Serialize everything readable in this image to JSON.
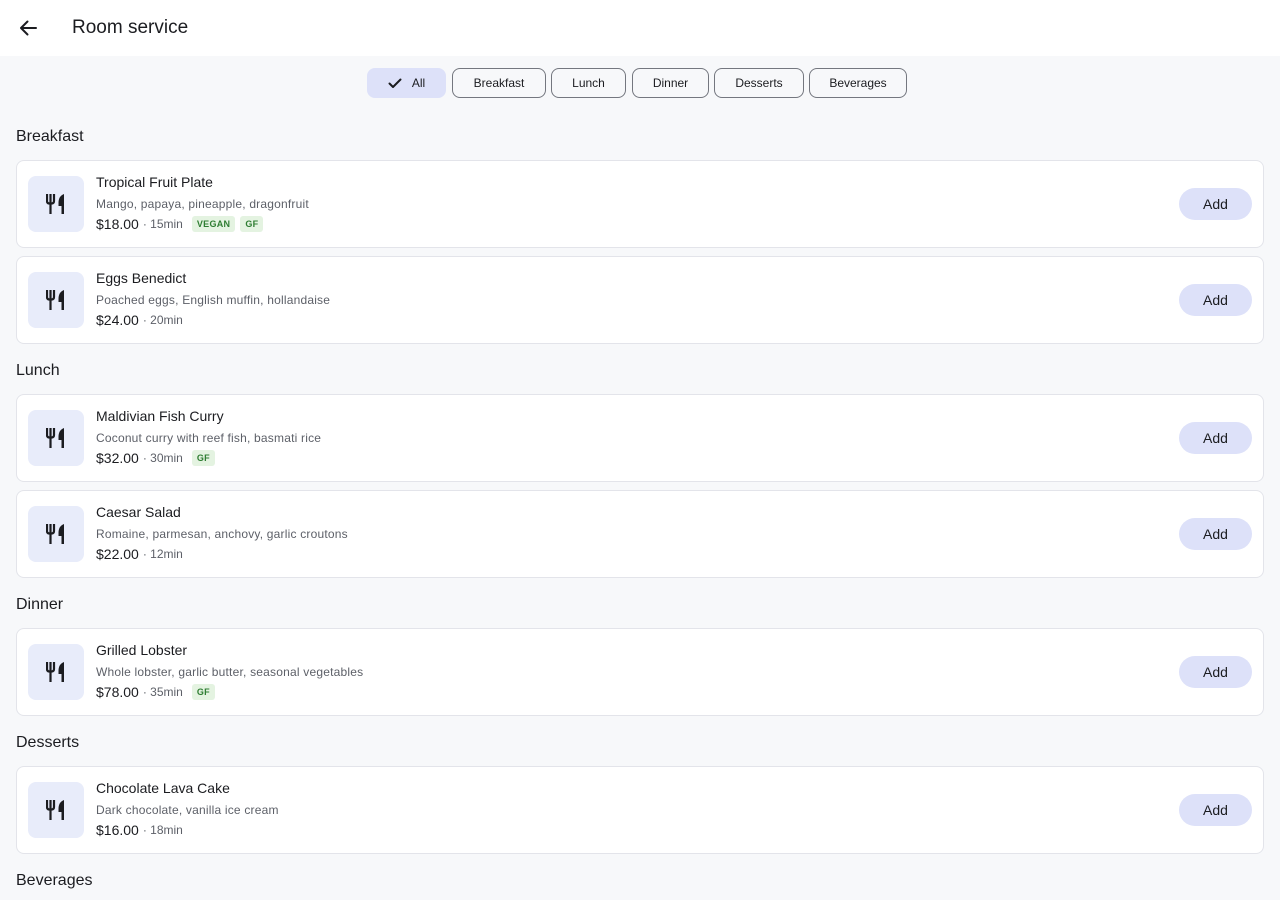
{
  "app_bar": {
    "title": "Room service",
    "back_icon": "arrow-back-icon"
  },
  "filters": [
    {
      "label": "All",
      "selected": true
    },
    {
      "label": "Breakfast",
      "selected": false
    },
    {
      "label": "Lunch",
      "selected": false
    },
    {
      "label": "Dinner",
      "selected": false
    },
    {
      "label": "Desserts",
      "selected": false
    },
    {
      "label": "Beverages",
      "selected": false
    }
  ],
  "sections": [
    {
      "title": "Breakfast",
      "items": [
        {
          "name": "Tropical Fruit Plate",
          "description": "Mango, papaya, pineapple, dragonfruit",
          "price": "$18.00",
          "time": "· 15min",
          "tags": [
            "VEGAN",
            "GF"
          ],
          "add_label": "Add"
        },
        {
          "name": "Eggs Benedict",
          "description": "Poached eggs, English muffin, hollandaise",
          "price": "$24.00",
          "time": "· 20min",
          "tags": [],
          "add_label": "Add"
        }
      ]
    },
    {
      "title": "Lunch",
      "items": [
        {
          "name": "Maldivian Fish Curry",
          "description": "Coconut curry with reef fish, basmati rice",
          "price": "$32.00",
          "time": "· 30min",
          "tags": [
            "GF"
          ],
          "add_label": "Add"
        },
        {
          "name": "Caesar Salad",
          "description": "Romaine, parmesan, anchovy, garlic croutons",
          "price": "$22.00",
          "time": "· 12min",
          "tags": [],
          "add_label": "Add"
        }
      ]
    },
    {
      "title": "Dinner",
      "items": [
        {
          "name": "Grilled Lobster",
          "description": "Whole lobster, garlic butter, seasonal vegetables",
          "price": "$78.00",
          "time": "· 35min",
          "tags": [
            "GF"
          ],
          "add_label": "Add"
        }
      ]
    },
    {
      "title": "Desserts",
      "items": [
        {
          "name": "Chocolate Lava Cake",
          "description": "Dark chocolate, vanilla ice cream",
          "price": "$16.00",
          "time": "· 18min",
          "tags": [],
          "add_label": "Add"
        }
      ]
    },
    {
      "title": "Beverages",
      "items": []
    }
  ],
  "icons": {
    "item_thumbnail": "restaurant-icon",
    "selected_chip": "check-icon"
  },
  "colors": {
    "accent_container": "#dde1f9",
    "tag_background": "#e4f3e1",
    "tag_text": "#2e7d32"
  }
}
